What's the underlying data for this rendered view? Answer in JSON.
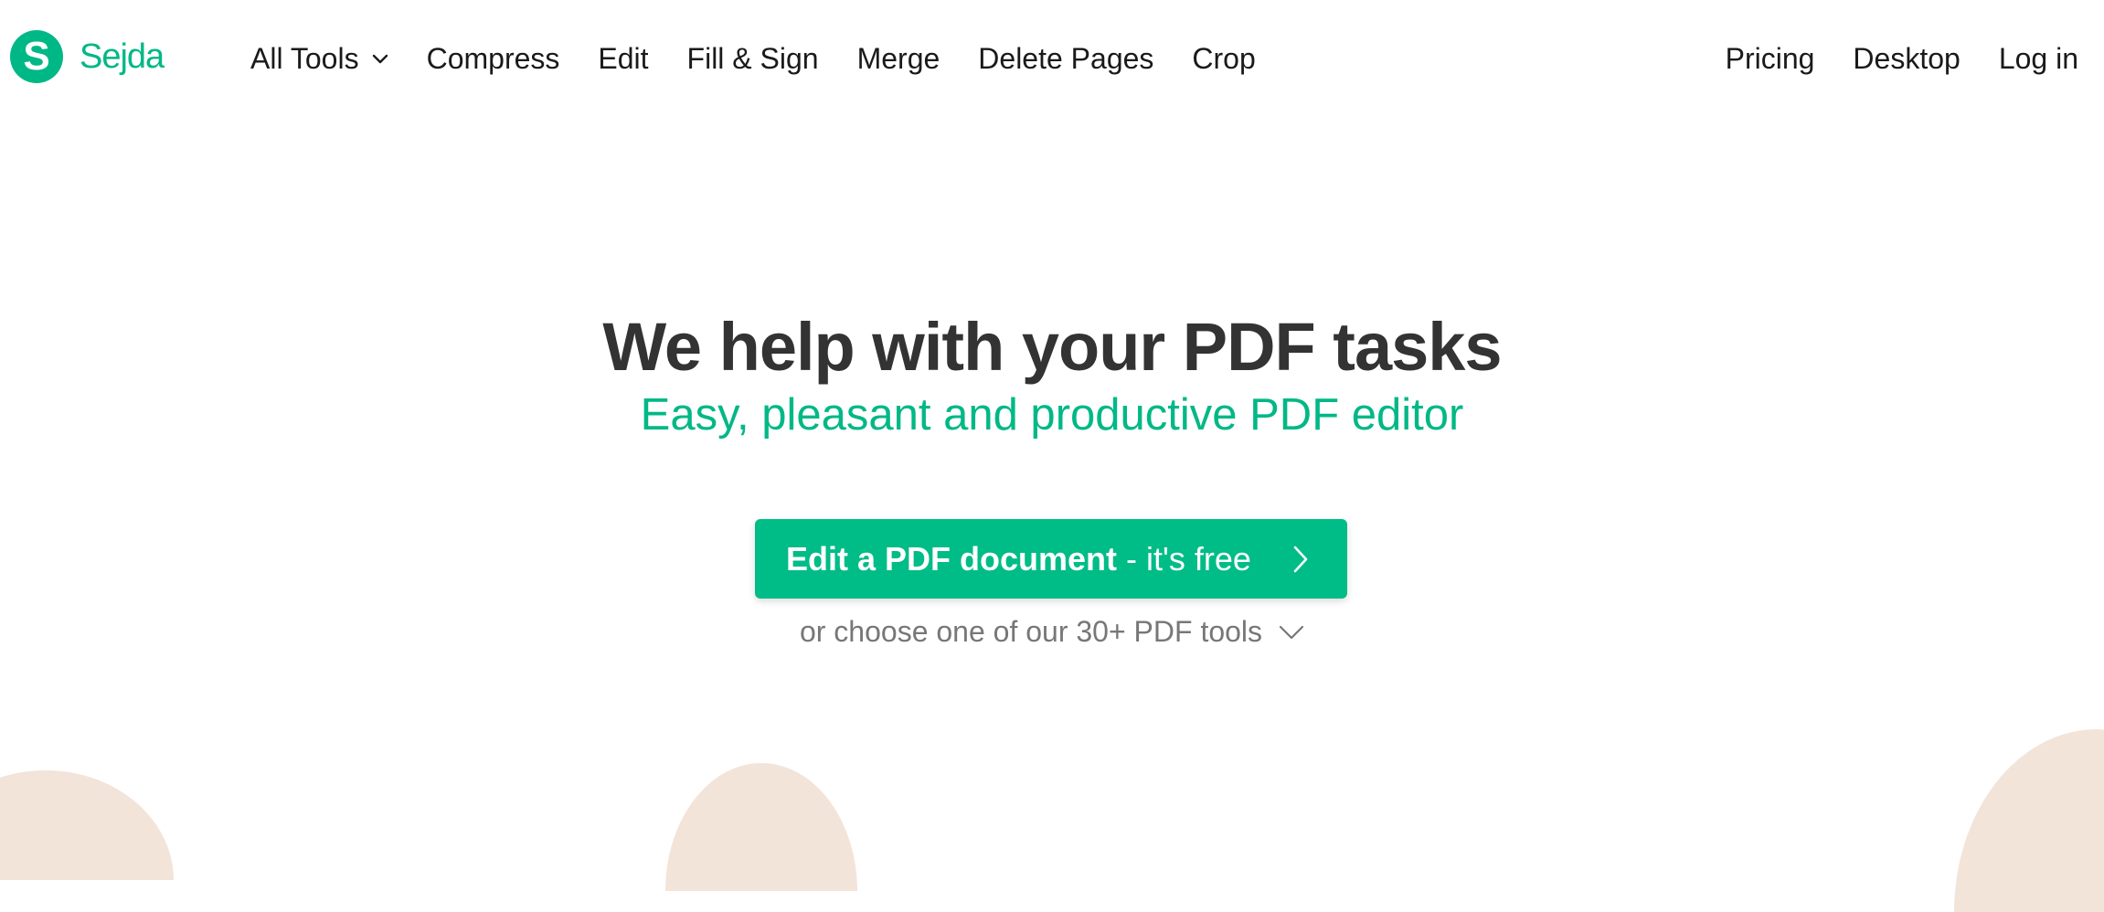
{
  "brand": {
    "logo_letter": "S",
    "name": "Sejda",
    "color": "#00b886"
  },
  "nav": {
    "items": [
      {
        "label": "All Tools",
        "has_dropdown": true
      },
      {
        "label": "Compress"
      },
      {
        "label": "Edit"
      },
      {
        "label": "Fill & Sign"
      },
      {
        "label": "Merge"
      },
      {
        "label": "Delete Pages"
      },
      {
        "label": "Crop"
      }
    ],
    "right_items": [
      {
        "label": "Pricing"
      },
      {
        "label": "Desktop"
      },
      {
        "label": "Log in"
      }
    ]
  },
  "hero": {
    "title": "We help with your PDF tasks",
    "subtitle": "Easy, pleasant and productive PDF editor",
    "cta": {
      "label_strong": "Edit a PDF document",
      "label_light": "- it's free",
      "icon": "chevron-right-icon"
    },
    "tools_link": {
      "label": "or choose one of our 30+ PDF tools",
      "icon": "chevron-down-icon"
    }
  },
  "colors": {
    "accent": "#00b886",
    "button": "#00bc87",
    "title": "#333333",
    "muted": "#777777",
    "blob": "#f3e4da"
  }
}
